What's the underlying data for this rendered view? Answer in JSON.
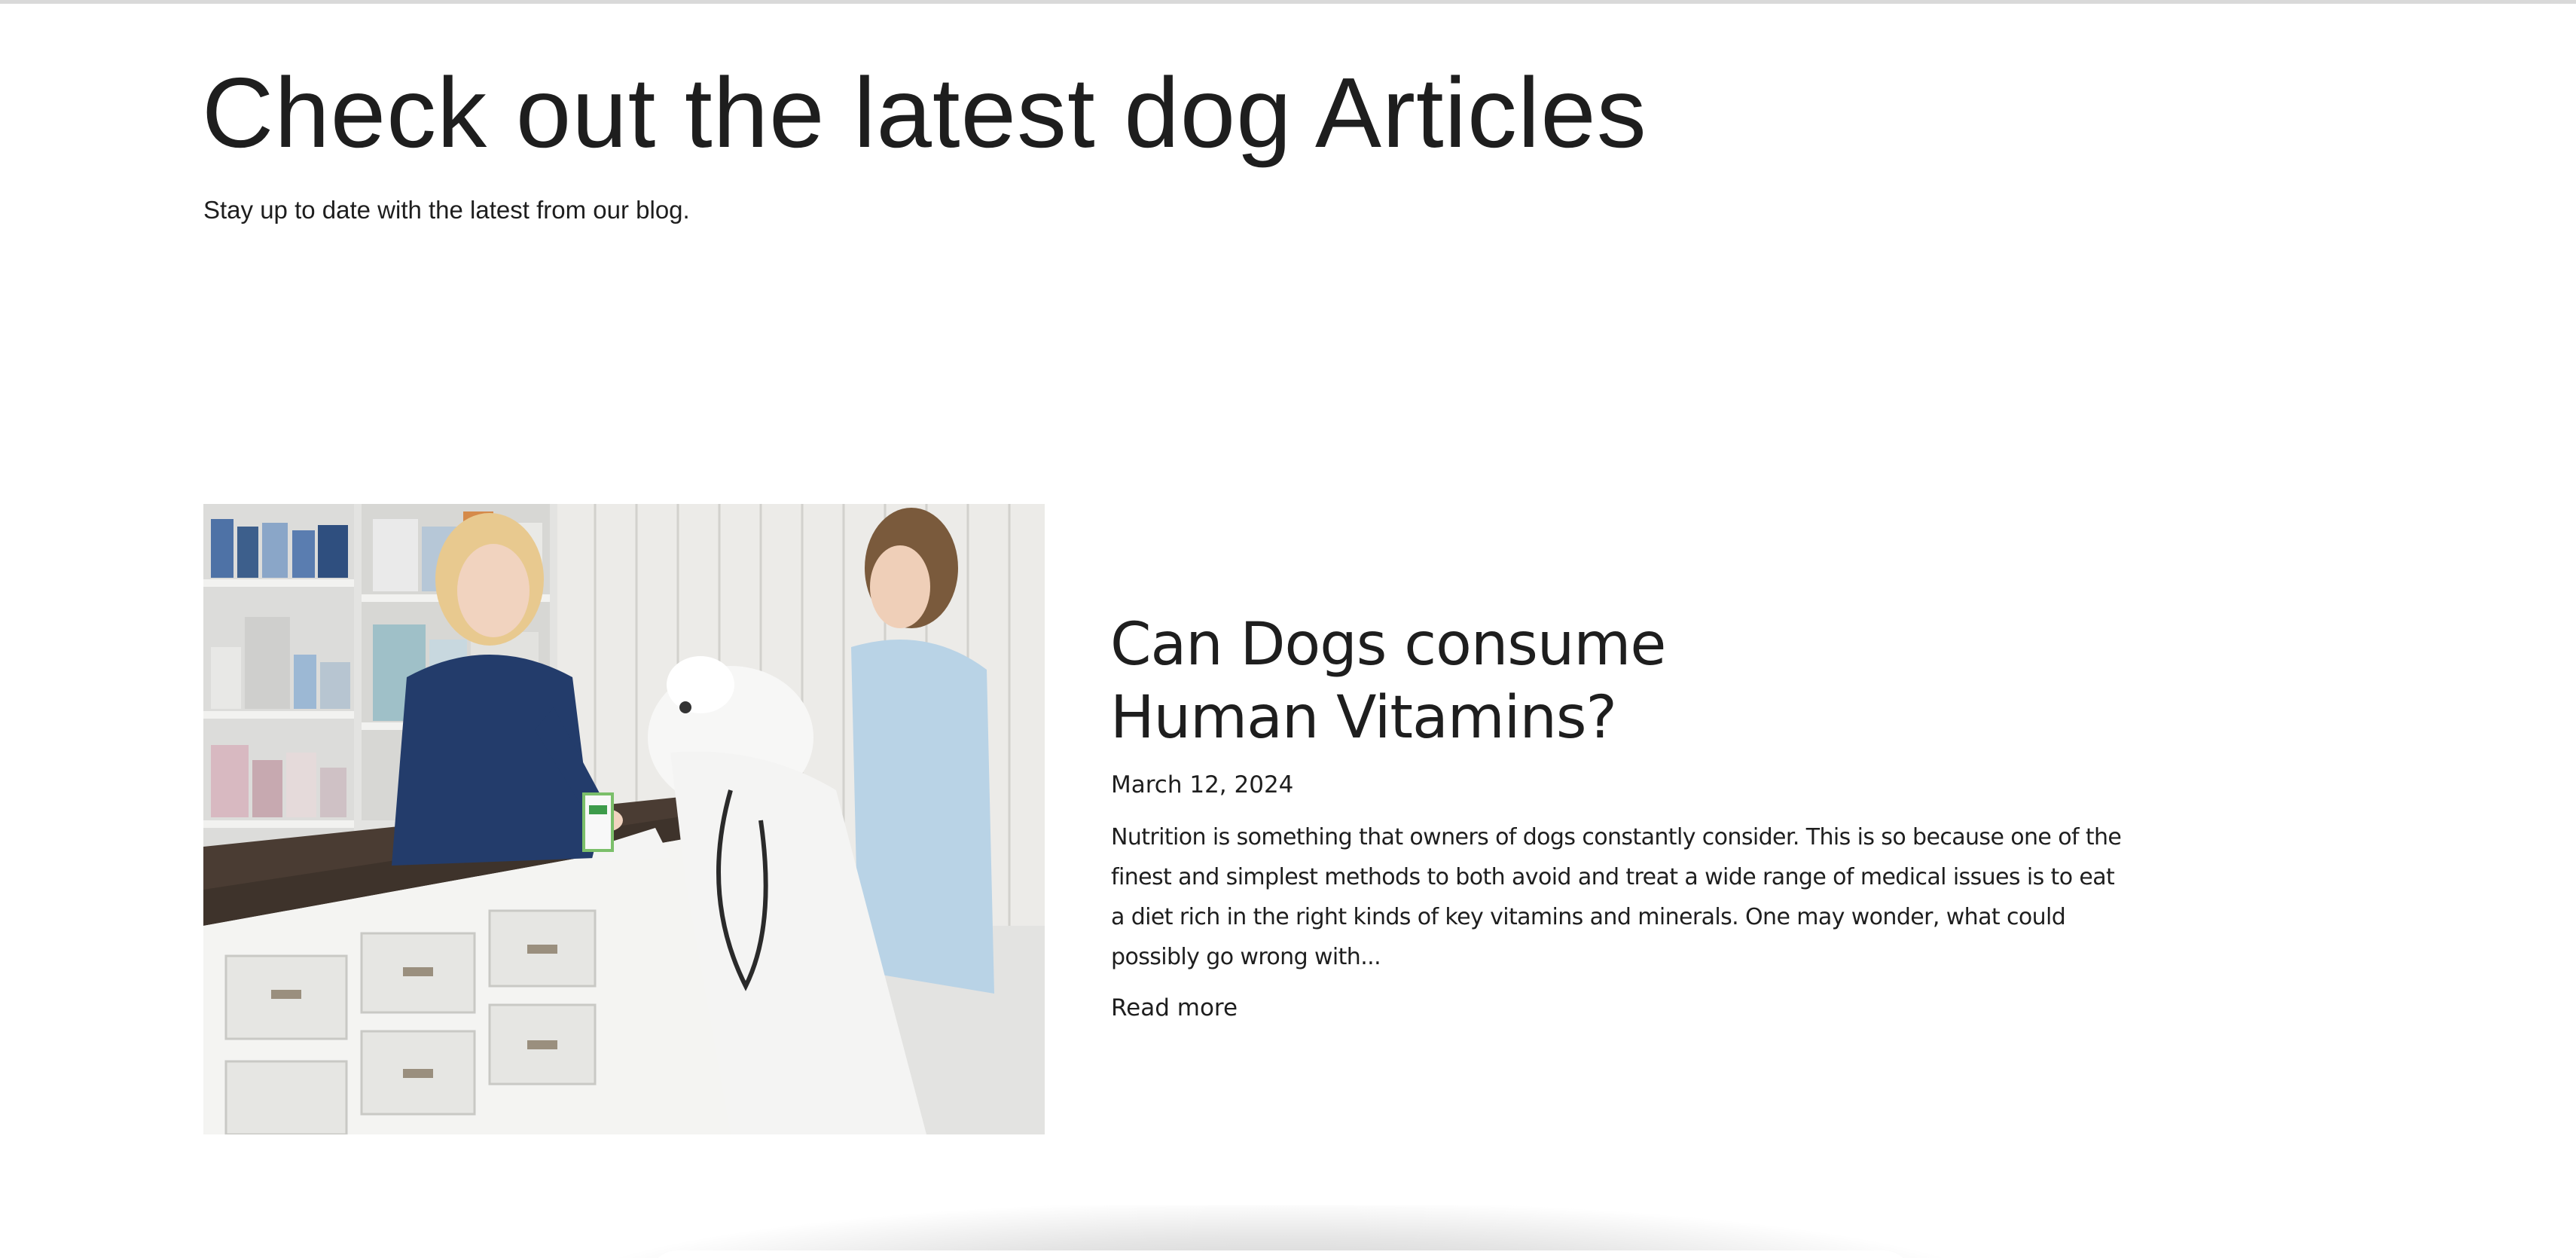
{
  "header": {
    "title": "Check out the latest dog Articles",
    "subtitle": "Stay up to date with the latest from our blog."
  },
  "article": {
    "title_lines": [
      "Can Dogs consume",
      "Human Vitamins?"
    ],
    "date": "March 12, 2024",
    "excerpt_lines": [
      "Nutrition is something that owners of dogs constantly consider. This is so because one of the",
      "finest and simplest methods to both avoid and treat a wide range of medical issues is to eat",
      "a diet rich in the right kinds of key vitamins and minerals. One may wonder, what could",
      "possibly go wrong with..."
    ],
    "read_more_label": "Read more"
  },
  "colors": {
    "text": "#1e1e1e",
    "background": "#ffffff",
    "counter_top": "#3e332b",
    "uniform": "#233c6b",
    "shirt": "#b9d3e6"
  }
}
